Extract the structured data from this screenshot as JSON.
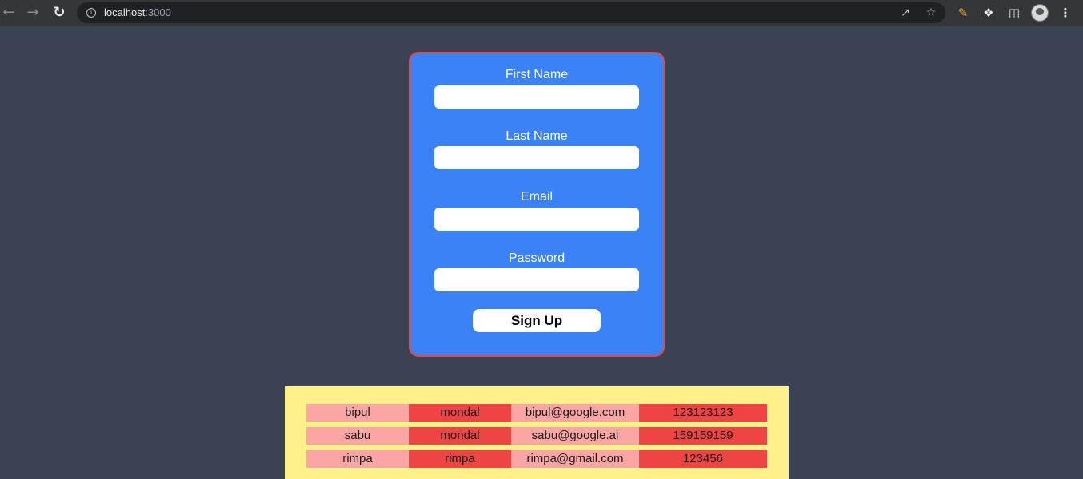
{
  "browser": {
    "url_host": "localhost",
    "url_port": ":3000",
    "icons": [
      "back-arrow-icon",
      "forward-arrow-icon",
      "reload-icon",
      "info-icon",
      "share-icon",
      "star-icon",
      "pen-icon",
      "puzzle-icon",
      "sidepanel-icon",
      "profile-avatar",
      "kebab-menu-icon"
    ]
  },
  "form": {
    "first_name_label": "First Name",
    "last_name_label": "Last Name",
    "email_label": "Email",
    "password_label": "Password",
    "first_name_value": "",
    "last_name_value": "",
    "email_value": "",
    "password_value": "",
    "submit_label": "Sign Up"
  },
  "table": {
    "rows": [
      {
        "first": "bipul",
        "last": "mondal",
        "email": "bipul@google.com",
        "password": "123123123"
      },
      {
        "first": "sabu",
        "last": "mondal",
        "email": "sabu@google.ai",
        "password": "159159159"
      },
      {
        "first": "rimpa",
        "last": "rimpa",
        "email": "rimpa@gmail.com",
        "password": "123456"
      }
    ]
  },
  "colors": {
    "page_bg": "#3a4354",
    "card_bg": "#3b82f6",
    "card_border": "#ef4444",
    "panel_bg": "#fef08a",
    "cell_light": "#fca5a5",
    "cell_dark": "#ef4444"
  }
}
